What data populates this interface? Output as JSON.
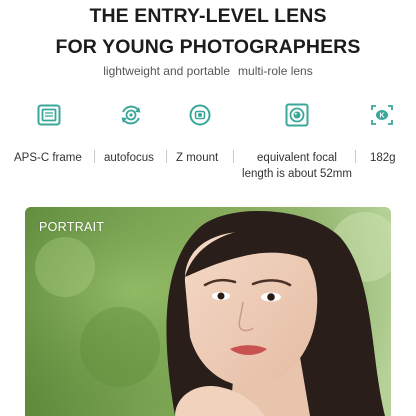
{
  "headline": {
    "line1": "THE ENTRY-LEVEL LENS",
    "line2": "FOR YOUNG PHOTOGRAPHERS"
  },
  "subline": {
    "part1": "lightweight and portable",
    "part2": "multi-role lens"
  },
  "features": [
    {
      "icon": "frame-sensor-icon",
      "label": "APS-C frame"
    },
    {
      "icon": "autofocus-icon",
      "label": "autofocus"
    },
    {
      "icon": "mount-icon",
      "label": "Z mount"
    },
    {
      "icon": "focal-length-icon",
      "label_line1": "equivalent focal",
      "label_line2": "length is about 52mm"
    },
    {
      "icon": "weight-icon",
      "label": "182g"
    }
  ],
  "photo": {
    "label": "PORTRAIT",
    "icon": "portrait-photo"
  },
  "colors": {
    "accent": "#3aa79a",
    "headline": "#1c1c1c"
  }
}
